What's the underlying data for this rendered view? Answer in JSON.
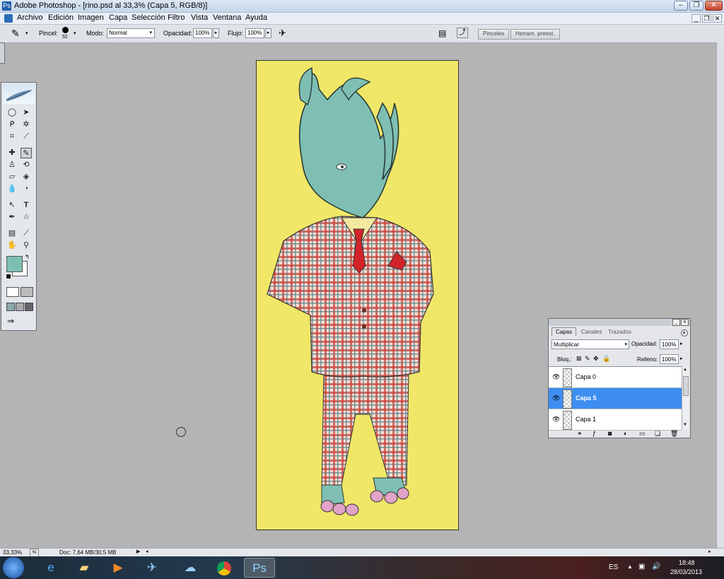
{
  "window": {
    "title": "Adobe Photoshop - [rino.psd al 33,3% (Capa 5, RGB/8)]"
  },
  "menu": [
    "Archivo",
    "Edición",
    "Imagen",
    "Capa",
    "Selección",
    "Filtro",
    "Vista",
    "Ventana",
    "Ayuda"
  ],
  "options": {
    "brush_label": "Pincel:",
    "brush_size": "52",
    "mode_label": "Modo:",
    "mode_value": "Normal",
    "opacity_label": "Opacidad:",
    "opacity_value": "100%",
    "flow_label": "Flujo:",
    "flow_value": "100%",
    "well_tabs": [
      "Pinceles",
      "Herram. preest."
    ]
  },
  "colors": {
    "foreground": "#7fbfb3",
    "background": "#ffffff",
    "canvas": "#f0e768",
    "selection": "#3d8ef0"
  },
  "layers_panel": {
    "tabs": [
      "Capas",
      "Canales",
      "Trazados"
    ],
    "blend_mode": "Multiplicar",
    "opacity_label": "Opacidad:",
    "opacity_value": "100%",
    "lock_label": "Bloq.:",
    "fill_label": "Relleno:",
    "fill_value": "100%",
    "layers": [
      {
        "name": "Capa 0",
        "selected": false
      },
      {
        "name": "Capa 5",
        "selected": true
      },
      {
        "name": "Capa 1",
        "selected": false
      }
    ]
  },
  "status": {
    "zoom": "33,33%",
    "doc": "Doc: 7,64 MB/30,5 MB"
  },
  "taskbar": {
    "language": "ES",
    "time": "18:48",
    "date": "28/03/2013"
  }
}
